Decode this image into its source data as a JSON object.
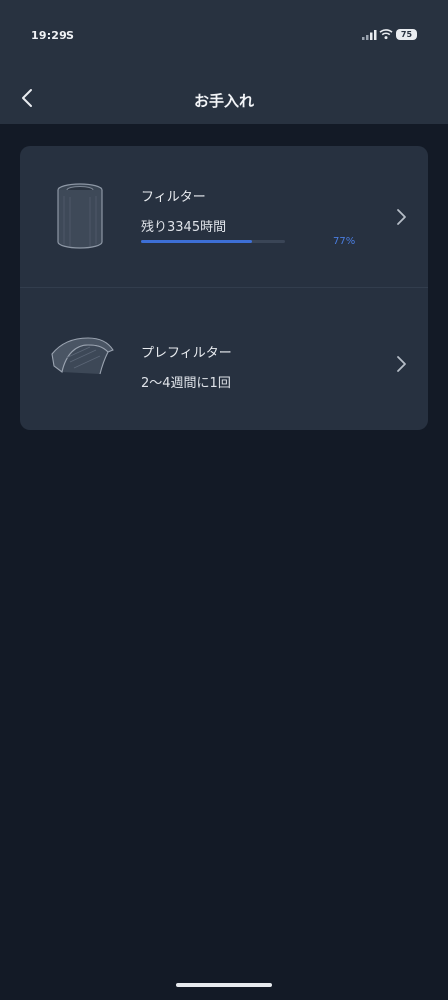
{
  "status_bar": {
    "time": "19:29",
    "carrier": "S",
    "battery": "75",
    "signal_icon": "signal-icon",
    "wifi_icon": "wifi-icon"
  },
  "nav": {
    "title": "お手入れ",
    "back_icon": "chevron-left-icon"
  },
  "items": [
    {
      "title": "フィルター",
      "subtitle": "残り3345時間",
      "progress_percent": 77,
      "progress_label": "77%",
      "icon": "filter-cylinder-icon"
    },
    {
      "title": "プレフィルター",
      "subtitle": "2〜4週間に1回",
      "icon": "prefilter-sheet-icon"
    }
  ],
  "colors": {
    "header_bg": "#283240",
    "page_bg": "#131a26",
    "card_bg": "#273140",
    "accent": "#3d6fd6"
  }
}
